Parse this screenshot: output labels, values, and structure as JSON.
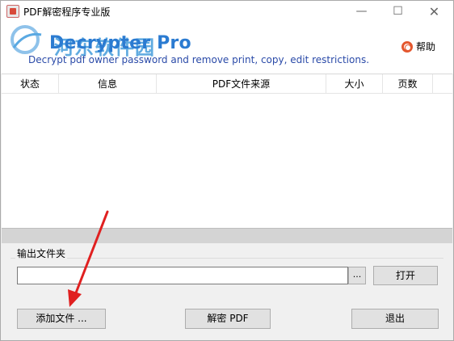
{
  "window": {
    "title": "PDF解密程序专业版",
    "min_glyph": "—",
    "max_glyph": "☐",
    "close_glyph": "✕"
  },
  "banner": {
    "watermark": "河东软件园",
    "brand": "Decrypter Pro",
    "tagline": "Decrypt pdf owner password and remove print, copy, edit  restrictions.",
    "help_label": "帮助"
  },
  "table": {
    "columns": [
      "状态",
      "信息",
      "PDF文件来源",
      "大小",
      "页数",
      ""
    ],
    "rows": []
  },
  "output": {
    "group_label": "输出文件夹",
    "path_value": "",
    "browse_label": "...",
    "open_label": "打开"
  },
  "actions": {
    "add_label": "添加文件 ...",
    "decrypt_label": "解密 PDF",
    "exit_label": "退出"
  },
  "colors": {
    "brand": "#2b7bd1",
    "tagline": "#2a4aa8",
    "arrow": "#e02020"
  }
}
